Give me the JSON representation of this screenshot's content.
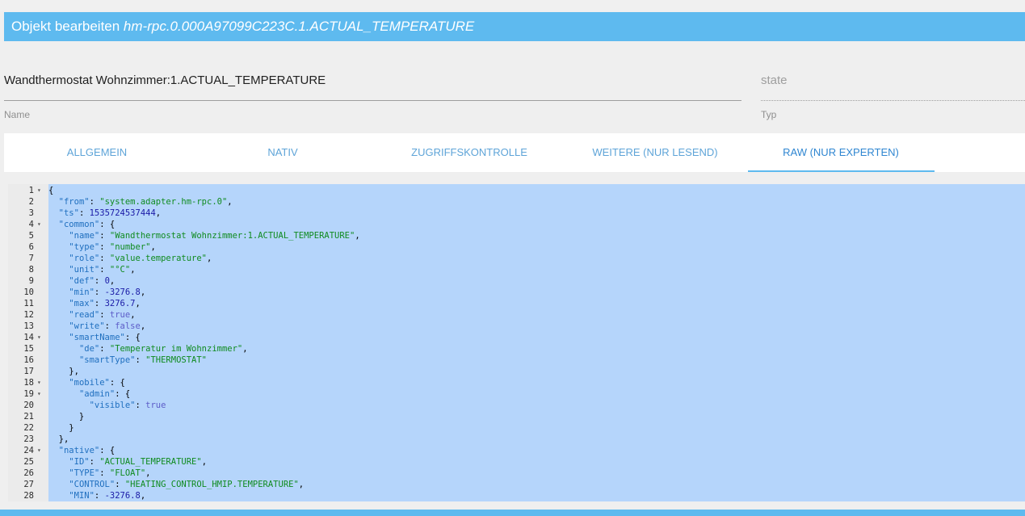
{
  "dialog": {
    "title_prefix": "Objekt bearbeiten ",
    "object_id": "hm-rpc.0.000A97099C223C.1.ACTUAL_TEMPERATURE"
  },
  "fields": {
    "name_value": "Wandthermostat Wohnzimmer:1.ACTUAL_TEMPERATURE",
    "name_label": "Name",
    "type_value": "state",
    "type_label": "Typ"
  },
  "tabs": [
    {
      "label": "ALLGEMEIN"
    },
    {
      "label": "NATIV"
    },
    {
      "label": "ZUGRIFFSKONTROLLE"
    },
    {
      "label": "WEITERE (NUR LESEND)"
    },
    {
      "label": "RAW (NUR EXPERTEN)"
    }
  ],
  "active_tab": "RAW (NUR EXPERTEN)",
  "colors": {
    "accent": "#5ebaef",
    "selection": "#b5d5fb",
    "json_key": "#1f6fbf",
    "json_string": "#0f8b1f",
    "json_number": "#1a1aa6",
    "json_boolean": "#5c5cc8"
  },
  "editor": {
    "lines": [
      {
        "num": "1",
        "fold": true,
        "text": "{"
      },
      {
        "num": "2",
        "fold": false,
        "text": "  \"from\": \"system.adapter.hm-rpc.0\","
      },
      {
        "num": "3",
        "fold": false,
        "text": "  \"ts\": 1535724537444,"
      },
      {
        "num": "4",
        "fold": true,
        "text": "  \"common\": {"
      },
      {
        "num": "5",
        "fold": false,
        "text": "    \"name\": \"Wandthermostat Wohnzimmer:1.ACTUAL_TEMPERATURE\","
      },
      {
        "num": "6",
        "fold": false,
        "text": "    \"type\": \"number\","
      },
      {
        "num": "7",
        "fold": false,
        "text": "    \"role\": \"value.temperature\","
      },
      {
        "num": "8",
        "fold": false,
        "text": "    \"unit\": \"°C\","
      },
      {
        "num": "9",
        "fold": false,
        "text": "    \"def\": 0,"
      },
      {
        "num": "10",
        "fold": false,
        "text": "    \"min\": -3276.8,"
      },
      {
        "num": "11",
        "fold": false,
        "text": "    \"max\": 3276.7,"
      },
      {
        "num": "12",
        "fold": false,
        "text": "    \"read\": true,"
      },
      {
        "num": "13",
        "fold": false,
        "text": "    \"write\": false,"
      },
      {
        "num": "14",
        "fold": true,
        "text": "    \"smartName\": {"
      },
      {
        "num": "15",
        "fold": false,
        "text": "      \"de\": \"Temperatur im Wohnzimmer\","
      },
      {
        "num": "16",
        "fold": false,
        "text": "      \"smartType\": \"THERMOSTAT\""
      },
      {
        "num": "17",
        "fold": false,
        "text": "    },"
      },
      {
        "num": "18",
        "fold": true,
        "text": "    \"mobile\": {"
      },
      {
        "num": "19",
        "fold": true,
        "text": "      \"admin\": {"
      },
      {
        "num": "20",
        "fold": false,
        "text": "        \"visible\": true"
      },
      {
        "num": "21",
        "fold": false,
        "text": "      }"
      },
      {
        "num": "22",
        "fold": false,
        "text": "    }"
      },
      {
        "num": "23",
        "fold": false,
        "text": "  },"
      },
      {
        "num": "24",
        "fold": true,
        "text": "  \"native\": {"
      },
      {
        "num": "25",
        "fold": false,
        "text": "    \"ID\": \"ACTUAL_TEMPERATURE\","
      },
      {
        "num": "26",
        "fold": false,
        "text": "    \"TYPE\": \"FLOAT\","
      },
      {
        "num": "27",
        "fold": false,
        "text": "    \"CONTROL\": \"HEATING_CONTROL_HMIP.TEMPERATURE\","
      },
      {
        "num": "28",
        "fold": false,
        "text": "    \"MIN\": -3276.8,"
      }
    ]
  }
}
